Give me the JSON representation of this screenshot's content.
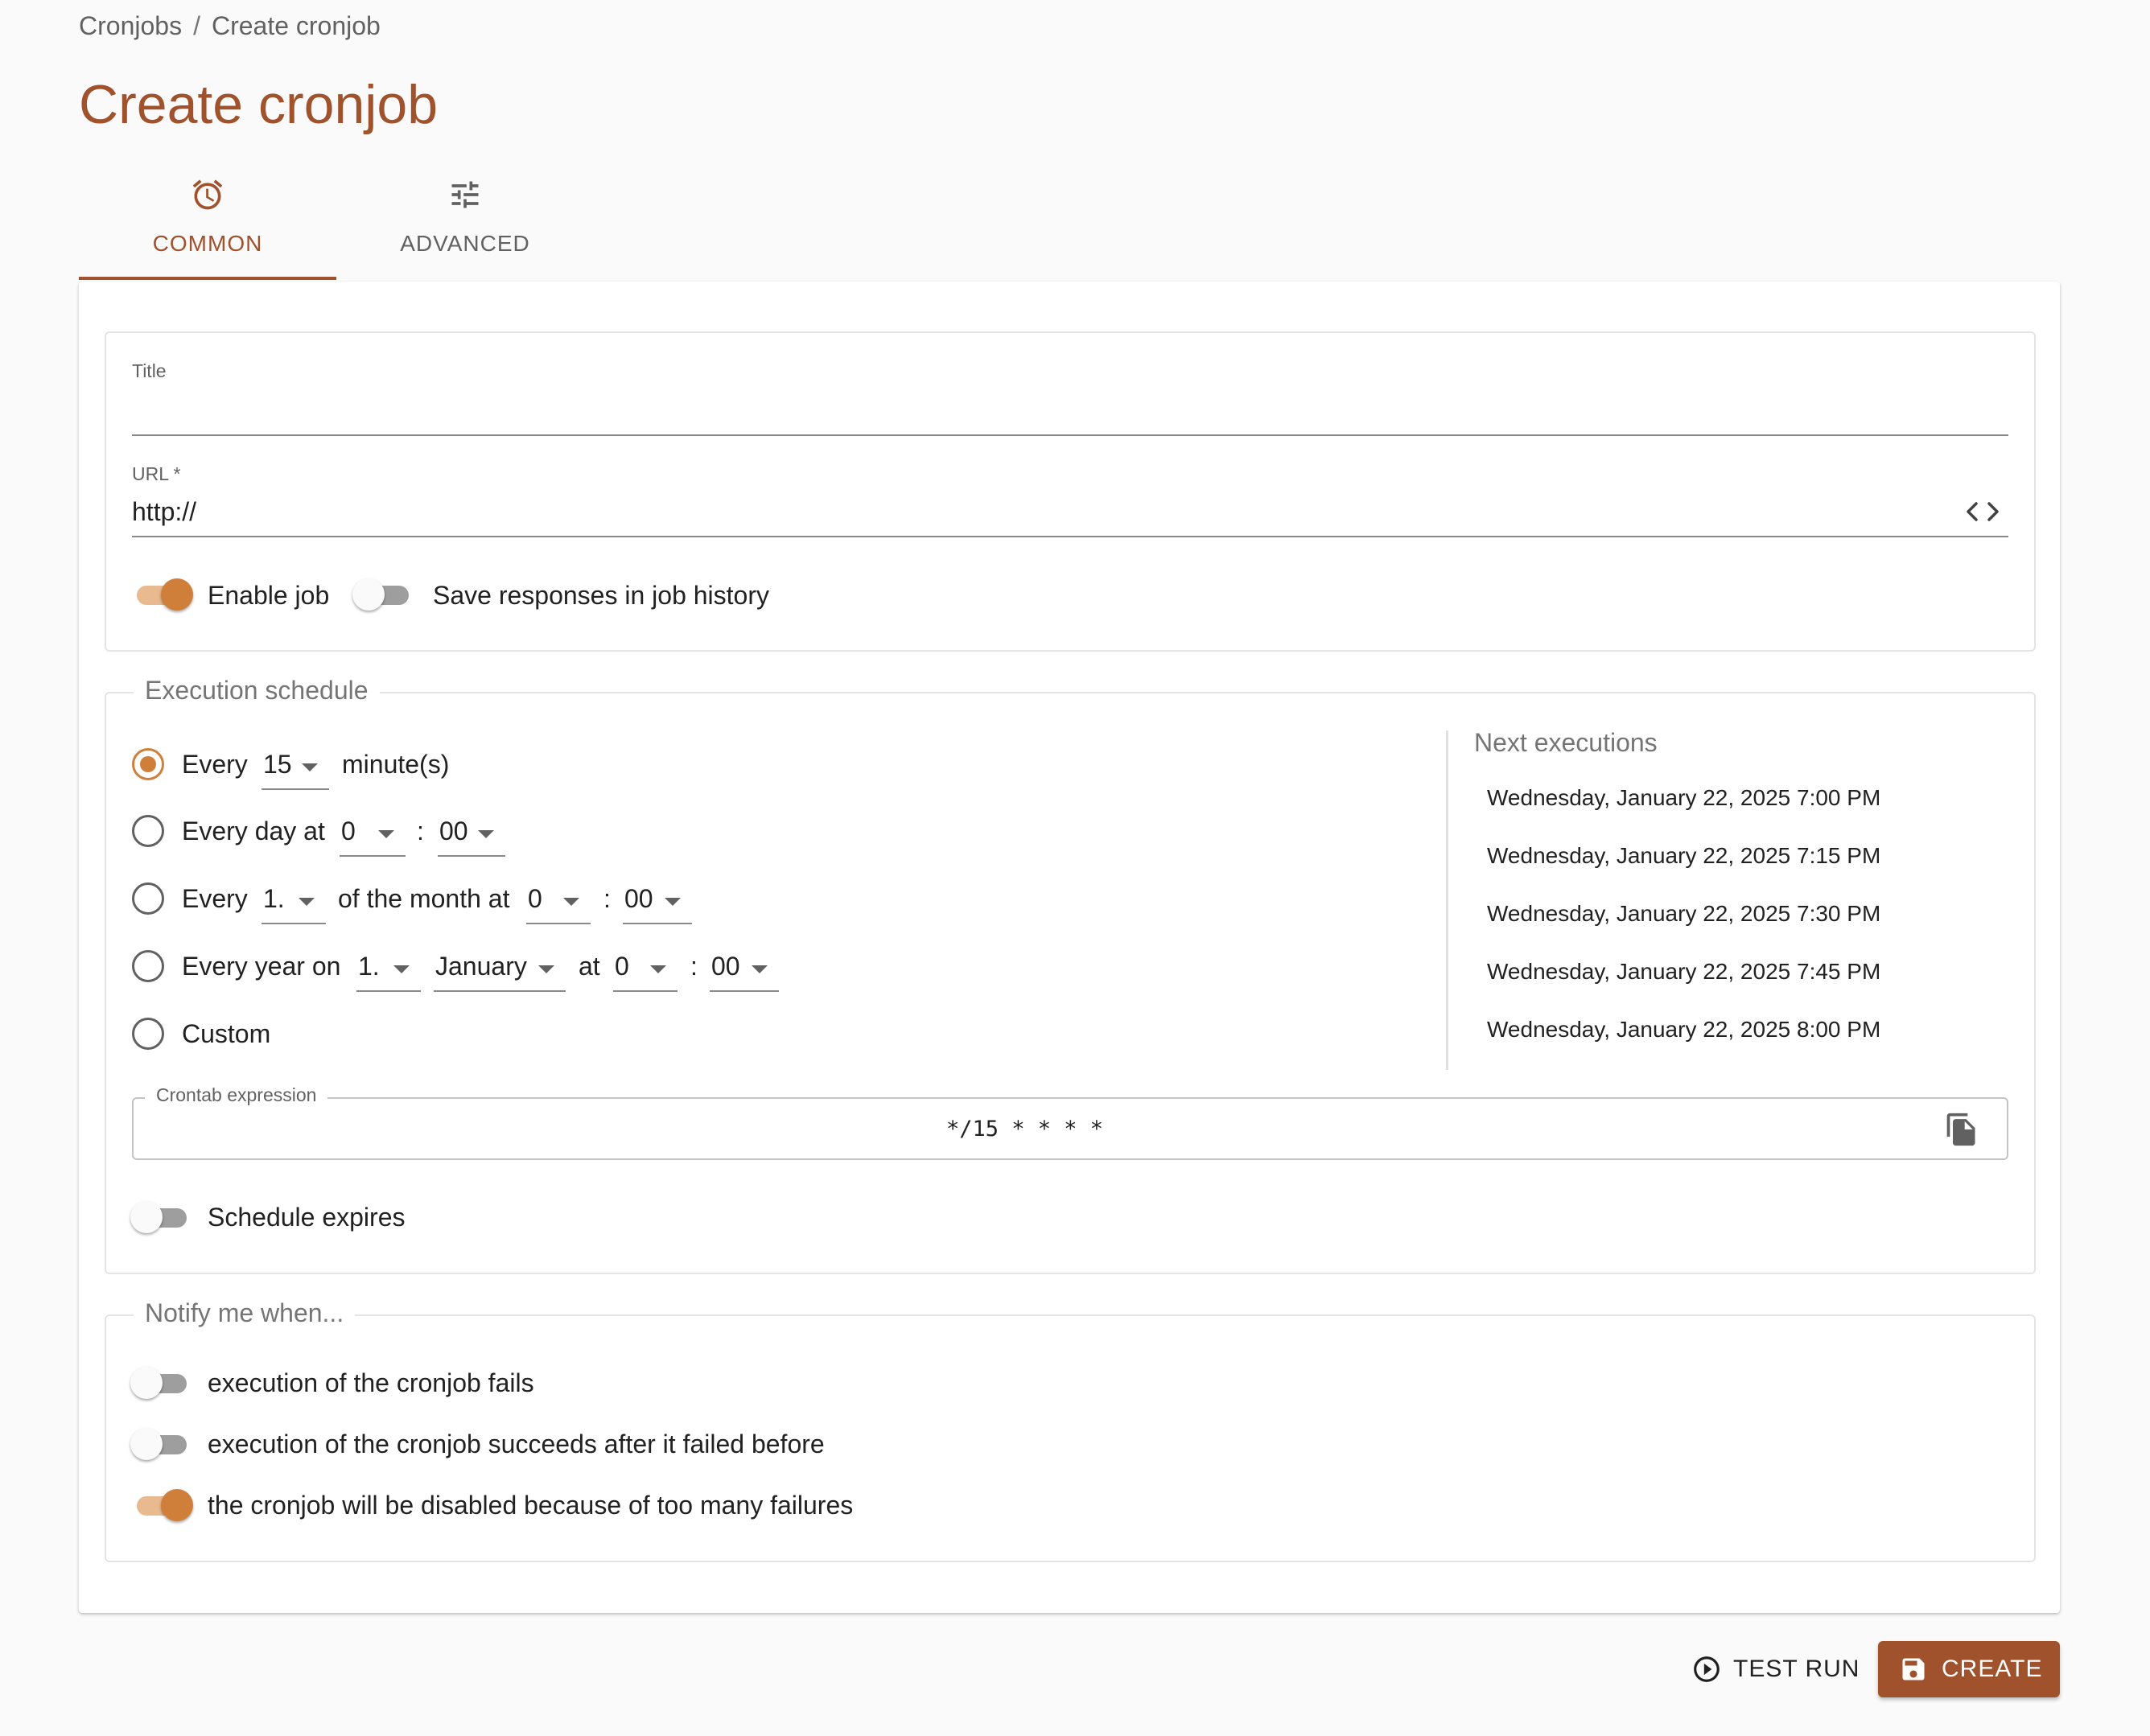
{
  "breadcrumb": {
    "parent": "Cronjobs",
    "separator": "/",
    "current": "Create cronjob"
  },
  "page": {
    "title": "Create cronjob"
  },
  "tabs": [
    {
      "label": "COMMON",
      "icon": "alarm-clock-icon",
      "active": true
    },
    {
      "label": "ADVANCED",
      "icon": "tune-sliders-icon",
      "active": false
    }
  ],
  "general": {
    "title_label": "Title",
    "title_value": "",
    "url_label": "URL *",
    "url_value": "http://",
    "url_icon": "code-brackets-icon",
    "enable_job_label": "Enable job",
    "enable_job_on": true,
    "save_responses_label": "Save responses in job history",
    "save_responses_on": false
  },
  "schedule": {
    "legend": "Execution schedule",
    "every_minutes": {
      "prefix": "Every",
      "value": "15",
      "suffix": "minute(s)",
      "selected": true
    },
    "every_day": {
      "prefix": "Every day at",
      "hour": "0",
      "colon": ":",
      "minute": "00",
      "selected": false
    },
    "every_month": {
      "prefix": "Every",
      "day": "1.",
      "middle": "of the month at",
      "hour": "0",
      "colon": ":",
      "minute": "00",
      "selected": false
    },
    "every_year": {
      "prefix": "Every year on",
      "day": "1.",
      "month": "January",
      "at": "at",
      "hour": "0",
      "colon": ":",
      "minute": "00",
      "selected": false
    },
    "custom": {
      "label": "Custom",
      "selected": false
    },
    "next_executions_title": "Next executions",
    "next_executions": [
      "Wednesday, January 22, 2025 7:00 PM",
      "Wednesday, January 22, 2025 7:15 PM",
      "Wednesday, January 22, 2025 7:30 PM",
      "Wednesday, January 22, 2025 7:45 PM",
      "Wednesday, January 22, 2025 8:00 PM"
    ],
    "crontab_label": "Crontab expression",
    "crontab_value": "*/15 * * * *",
    "crontab_icon": "copy-icon",
    "expires_label": "Schedule expires",
    "expires_on": false
  },
  "notify": {
    "legend": "Notify me when...",
    "items": [
      {
        "label": "execution of the cronjob fails",
        "on": false
      },
      {
        "label": "execution of the cronjob succeeds after it failed before",
        "on": false
      },
      {
        "label": "the cronjob will be disabled because of too many failures",
        "on": true
      }
    ]
  },
  "actions": {
    "test_run_label": "TEST RUN",
    "test_run_icon": "play-circle-icon",
    "create_label": "CREATE",
    "create_icon": "save-icon"
  },
  "colors": {
    "accent": "#a0522d",
    "toggle_on": "#cf7f3a",
    "toggle_track_on": "#e9b98f"
  }
}
